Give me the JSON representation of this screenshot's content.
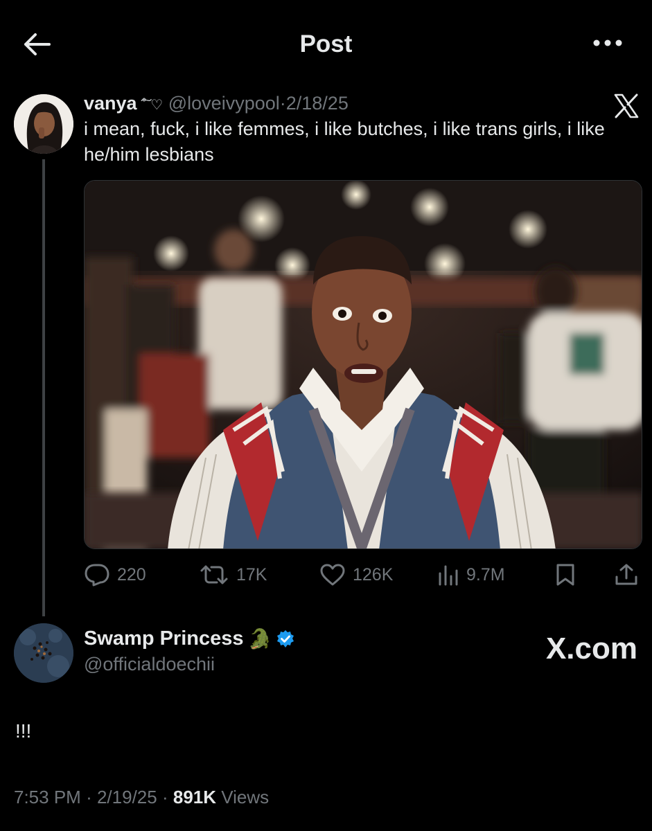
{
  "header": {
    "title": "Post",
    "back_icon": "arrow-left-icon",
    "more_icon": "ellipsis-icon"
  },
  "quoted_post": {
    "name": "vanya",
    "name_decoration": "͠˚ ♡",
    "handle": "@loveivypool",
    "separator": "·",
    "date": "2/18/25",
    "text": "i mean, fuck, i like femmes, i like butches, i like trans girls, i like he/him lesbians",
    "actions": {
      "replies": "220",
      "reposts": "17K",
      "likes": "126K",
      "views": "9.7M"
    }
  },
  "author": {
    "name": "Swamp Princess",
    "emoji": "🐊",
    "handle": "@officialdoechii",
    "verified": true,
    "watermark": "X.com"
  },
  "post": {
    "text": "!!!",
    "time": "7:53 PM",
    "date": "2/19/25",
    "views_count": "891K",
    "views_label": "Views"
  },
  "colors": {
    "background": "#000000",
    "text": "#e7e9ea",
    "muted": "#71767b",
    "verified": "#1d9bf0"
  }
}
